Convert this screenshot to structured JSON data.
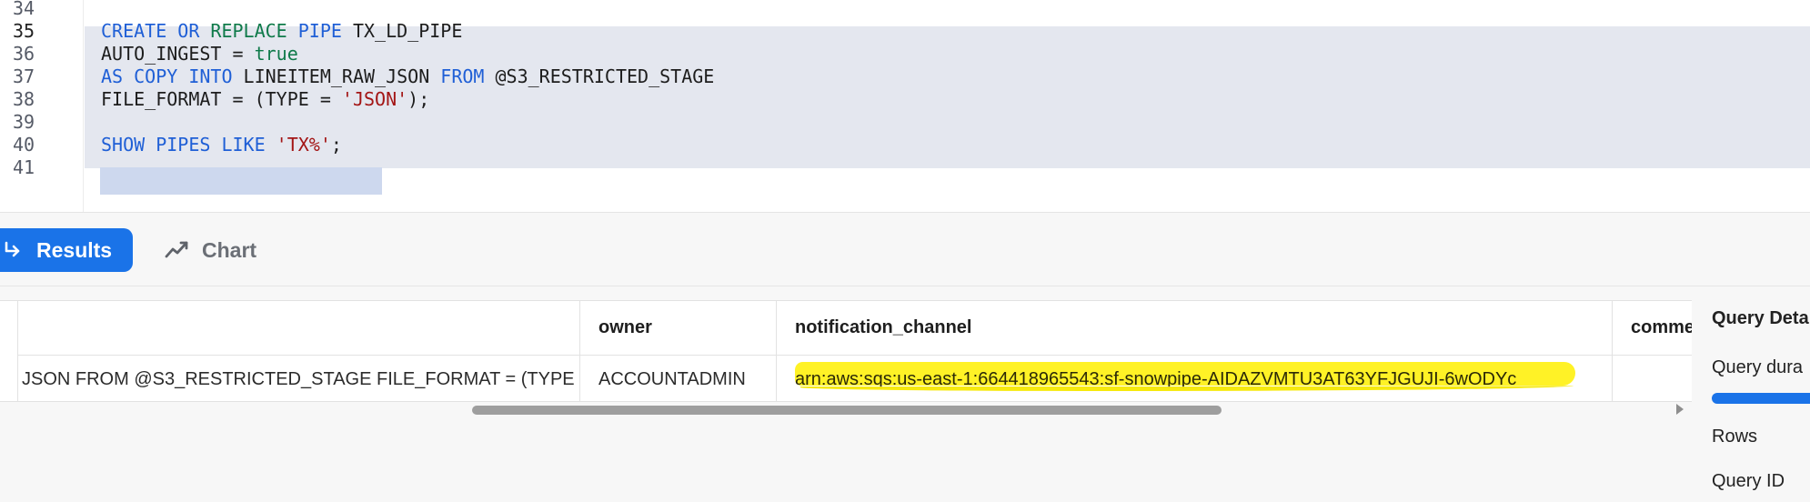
{
  "editor": {
    "line_numbers": [
      "34",
      "35",
      "36",
      "37",
      "38",
      "39",
      "40",
      "41"
    ],
    "lines": [
      {
        "tokens": []
      },
      {
        "tokens": [
          {
            "t": "CREATE OR ",
            "c": "kw"
          },
          {
            "t": "REPLACE ",
            "c": "val"
          },
          {
            "t": "PIPE ",
            "c": "kw"
          },
          {
            "t": "TX_LD_PIPE",
            "c": "plain"
          }
        ]
      },
      {
        "tokens": [
          {
            "t": "AUTO_INGEST = ",
            "c": "plain"
          },
          {
            "t": "true",
            "c": "val"
          }
        ]
      },
      {
        "tokens": [
          {
            "t": "AS COPY INTO ",
            "c": "kw"
          },
          {
            "t": "LINEITEM_RAW_JSON ",
            "c": "plain"
          },
          {
            "t": "FROM ",
            "c": "kw"
          },
          {
            "t": "@S3_RESTRICTED_STAGE",
            "c": "plain"
          }
        ]
      },
      {
        "tokens": [
          {
            "t": "FILE_FORMAT = (TYPE = ",
            "c": "plain"
          },
          {
            "t": "'JSON'",
            "c": "str"
          },
          {
            "t": ");",
            "c": "plain"
          }
        ]
      },
      {
        "tokens": []
      },
      {
        "tokens": [
          {
            "t": "SHOW PIPES LIKE ",
            "c": "kw"
          },
          {
            "t": "'TX%'",
            "c": "str"
          },
          {
            "t": ";",
            "c": "plain"
          }
        ]
      },
      {
        "tokens": []
      }
    ]
  },
  "toolbar": {
    "results_label": "Results",
    "chart_label": "Chart",
    "results_icon": "return-arrow-icon",
    "chart_icon": "line-chart-icon"
  },
  "table": {
    "columns": [
      {
        "key": "definition",
        "header": ""
      },
      {
        "key": "owner",
        "header": "owner"
      },
      {
        "key": "notification_channel",
        "header": "notification_channel"
      },
      {
        "key": "comment",
        "header": "comme"
      }
    ],
    "row": {
      "definition": "JSON FROM @S3_RESTRICTED_STAGE FILE_FORMAT = (TYPE",
      "owner": "ACCOUNTADMIN",
      "notification_channel": "arn:aws:sqs:us-east-1:664418965543:sf-snowpipe-AIDAZVMTU3AT63YFJGUJI-6wODYc",
      "comment": ""
    }
  },
  "details": {
    "title": "Query Deta",
    "duration_label": "Query dura",
    "rows_label": "Rows",
    "query_id_label": "Query ID"
  },
  "colors": {
    "accent": "#1a73e8",
    "highlight": "#fff000",
    "keyword": "#1f5fd6",
    "value": "#0f7a4a",
    "string": "#a31515"
  }
}
